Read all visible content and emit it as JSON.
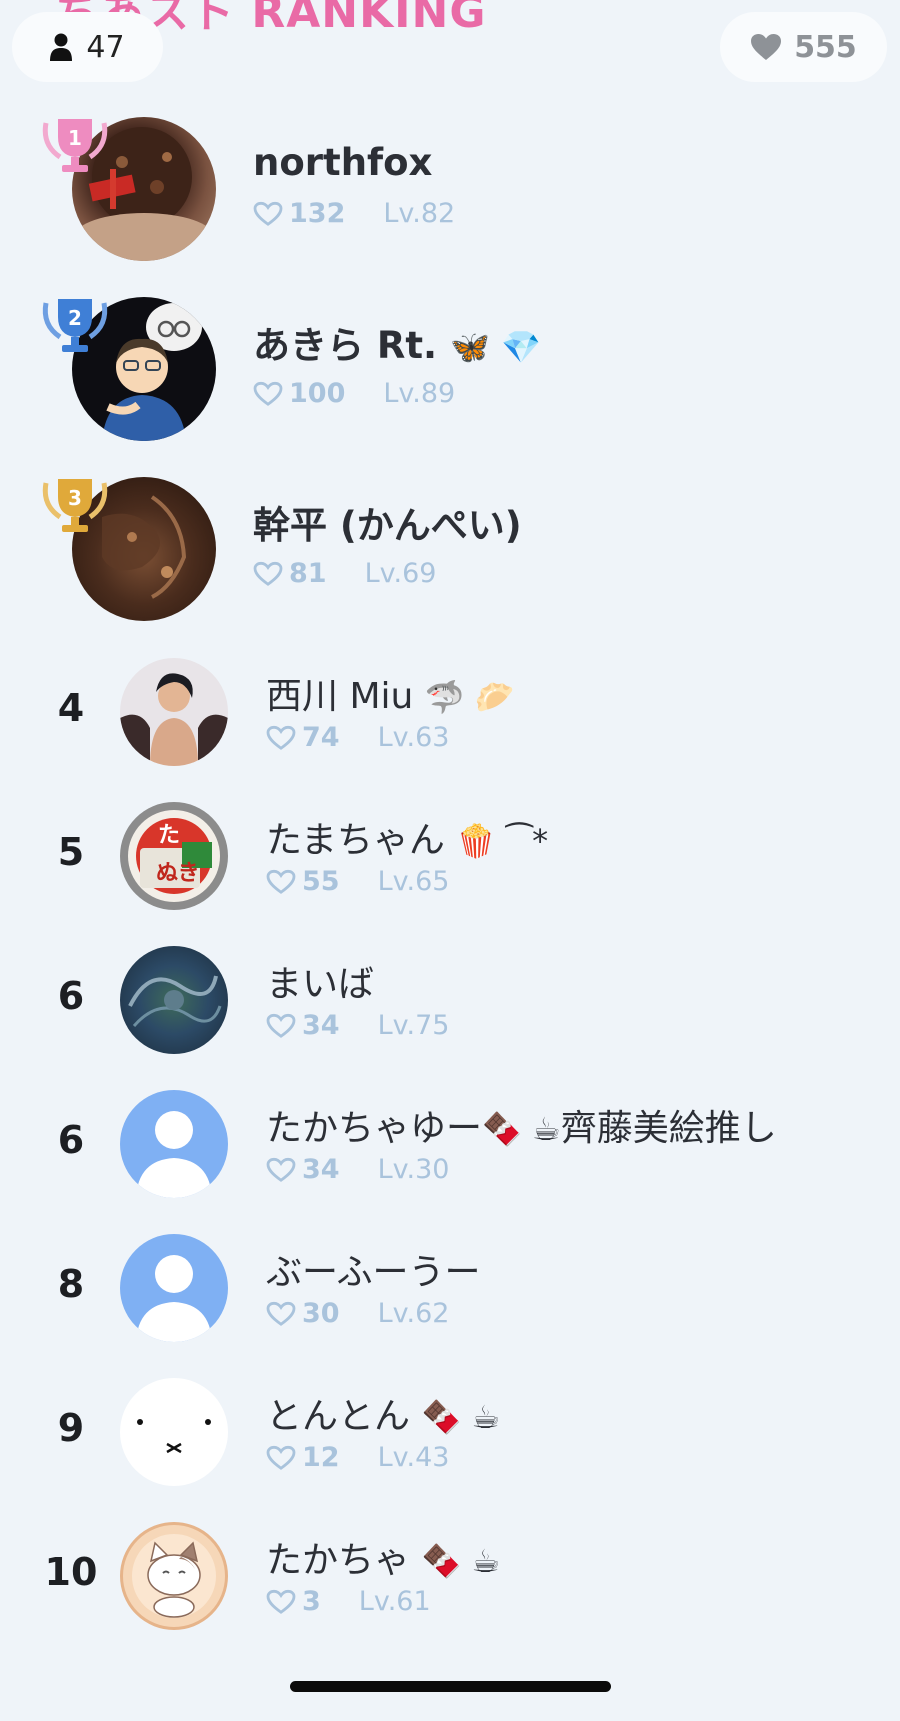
{
  "header": {
    "title": "ちあスト RANKING",
    "user_count": "47",
    "total_likes": "555"
  },
  "colors": {
    "background": "#eff4f9",
    "title_pink": "#e96aa6",
    "gold": "#e0a93a",
    "silver_blue": "#3f7fd6",
    "pink_badge": "#ee8cc0",
    "default_avatar": "#7fb0f3",
    "stat_text": "#a9c3dc"
  },
  "ranking": [
    {
      "rank": "1",
      "name": "northfox",
      "likes": "132",
      "level": "Lv.82",
      "avatar": "photo-cake-avatar",
      "badge": "pink-trophy-icon"
    },
    {
      "rank": "2",
      "name": "あきら Rt.",
      "emojis": "🦋 💎",
      "likes": "100",
      "level": "Lv.89",
      "avatar": "illustration-avatar",
      "badge": "blue-trophy-icon"
    },
    {
      "rank": "3",
      "name": "幹平 (かんぺい)",
      "likes": "81",
      "level": "Lv.69",
      "avatar": "photo-dark-avatar",
      "badge": "gold-trophy-icon"
    },
    {
      "rank": "4",
      "name": "西川 Miu",
      "emojis": "🦈 🥟",
      "likes": "74",
      "level": "Lv.63",
      "avatar": "photo-person-avatar"
    },
    {
      "rank": "5",
      "name": "たまちゃん",
      "emojis": "🍿 ⁀*",
      "likes": "55",
      "level": "Lv.65",
      "avatar": "photo-noodle-avatar"
    },
    {
      "rank": "6",
      "name": "まいば",
      "likes": "34",
      "level": "Lv.75",
      "avatar": "photo-abstract-avatar"
    },
    {
      "rank": "6",
      "name": "たかちゃゆー",
      "emojis": "🍫 ☕",
      "name_suffix": "齊藤美絵推し",
      "likes": "34",
      "level": "Lv.30",
      "avatar": "default-user-avatar"
    },
    {
      "rank": "8",
      "name": "ぶーふーうー",
      "likes": "30",
      "level": "Lv.62",
      "avatar": "default-user-avatar"
    },
    {
      "rank": "9",
      "name": "とんとん",
      "emojis": "🍫 ☕",
      "likes": "12",
      "level": "Lv.43",
      "avatar": "miffy-face-avatar"
    },
    {
      "rank": "10",
      "name": "たかちゃ",
      "emojis": "🍫 ☕",
      "likes": "3",
      "level": "Lv.61",
      "avatar": "cat-illustration-avatar"
    }
  ]
}
